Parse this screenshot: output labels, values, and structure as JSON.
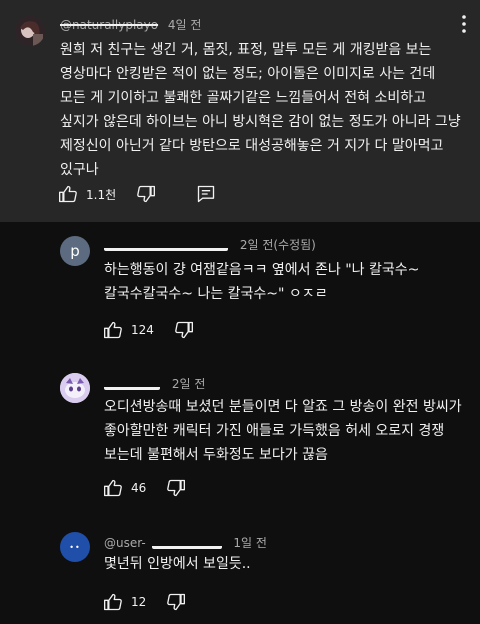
{
  "main_comment": {
    "author": "@naturallyplayo",
    "time": "4일 전",
    "text": "원희 저 친구는 생긴 거, 몸짓, 표정, 말투 모든 게 개킹받음 보는 영상마다 안킹받은 적이 없는 정도; 아이돌은 이미지로 사는 건데 모든 게 기이하고 불쾌한 골짜기같은 느낌들어서 전혀 소비하고 싶지가 않은데 하이브는 아니 방시혁은 감이 없는 정도가 아니라 그냥 제정신이 아닌거 같다 방탄으로 대성공해놓은 거 지가 다 말아먹고 있구나",
    "likes": "1.1천",
    "menu_icon": "more-vert-icon"
  },
  "replies": [
    {
      "avatar_letter": "p",
      "avatar_color": "#5c6b7f",
      "time": "2일 전(수정됨)",
      "text": "하는행동이 걍 여잼같음ㅋㅋ 옆에서 존나 \"나 칼국수~ 칼국수칼국수~ 나는 칼국수~\" ㅇㅈㄹ",
      "likes": "124"
    },
    {
      "avatar_letter": "",
      "avatar_color": "#c9b6e4",
      "time": "2일 전",
      "text": "오디션방송때 보셨던 분들이면 다 알죠 그 방송이 완전 방씨가 좋아할만한 캐릭터 가진 애들로 가득했음 허세 오로지 경쟁 보는데 불편해서 두화정도 보다가 끊음",
      "likes": "46"
    },
    {
      "avatar_letter": "",
      "avatar_color": "#1f4fa8",
      "author": "@user-",
      "time": "1일 전",
      "text": "몇년뒤 인방에서 보일듯..",
      "likes": "12"
    }
  ],
  "colors": {
    "bg": "#0f0f0f",
    "highlight": "#272727",
    "text": "#f1f1f1",
    "muted": "#aaaaaa"
  }
}
